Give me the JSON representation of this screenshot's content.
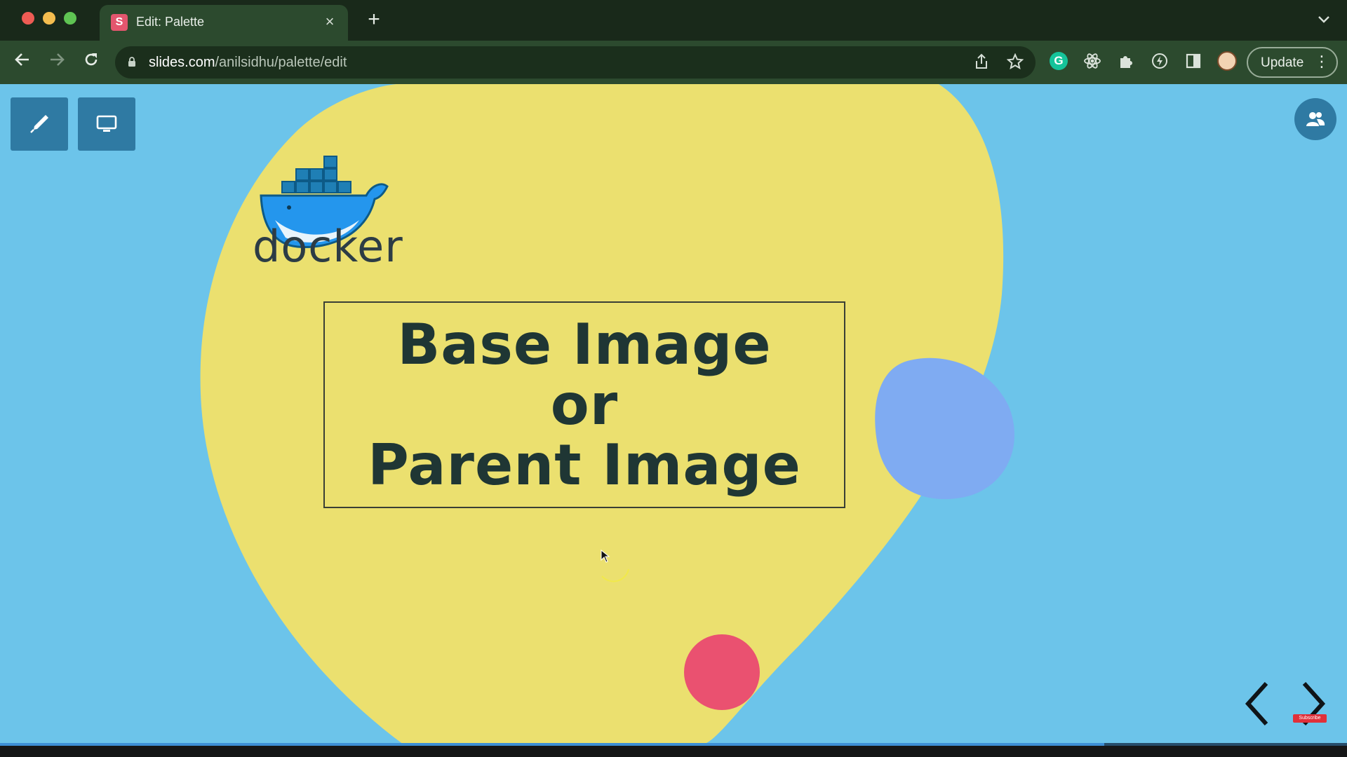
{
  "browser": {
    "tab": {
      "favicon_letter": "S",
      "title": "Edit: Palette"
    },
    "new_tab_symbol": "+",
    "url": {
      "host": "slides.com",
      "path": "/anilsidhu/palette/edit"
    },
    "update_label": "Update"
  },
  "slide": {
    "logo_word": "docker",
    "title_lines": [
      "Base Image",
      "or",
      "Parent Image"
    ],
    "colors": {
      "background": "#6cc4ea",
      "blob_yellow": "#ebe06f",
      "blob_blue": "#7fabf2",
      "blob_pink": "#ea5170",
      "title_text": "#1f3634"
    }
  },
  "icons": {
    "edit": "pencil-icon",
    "present": "monitor-icon",
    "collaborate": "people-icon",
    "prev": "chevron-left-icon",
    "next": "chevron-right-icon"
  },
  "progress": {
    "fraction": 0.82
  },
  "watermark": {
    "badge": "Subscribe"
  }
}
